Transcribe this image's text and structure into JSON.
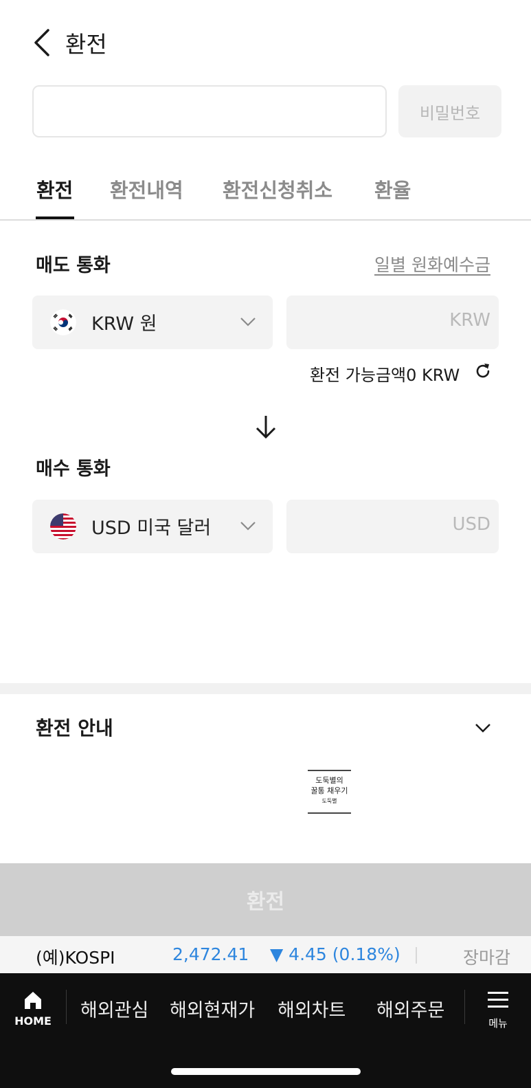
{
  "header": {
    "title": "환전"
  },
  "account": {
    "password_label": "비밀번호"
  },
  "tabs": [
    {
      "label": "환전",
      "active": true
    },
    {
      "label": "환전내역",
      "active": false
    },
    {
      "label": "환전신청취소",
      "active": false
    },
    {
      "label": "환율",
      "active": false
    }
  ],
  "sell": {
    "label": "매도 통화",
    "deposit_link": "일별 원화예수금",
    "currency": "KRW 원",
    "flag_icon": "korea-flag-icon",
    "amount_unit": "KRW",
    "available_text": "환전 가능금액0 KRW"
  },
  "buy": {
    "label": "매수 통화",
    "currency": "USD 미국 달러",
    "flag_icon": "usa-flag-icon",
    "amount_unit": "USD"
  },
  "guide": {
    "title": "환전 안내"
  },
  "watermark": {
    "line1": "도둑별의",
    "line2": "꿀통 채우기",
    "line3": "도둑별"
  },
  "exchange_button": "환전",
  "ticker": {
    "name": "(예)KOSPI",
    "value": "2,472.41",
    "change": "▼ 4.45 (0.18%)",
    "status": "장마감",
    "color": "#2e86de"
  },
  "bottom_nav": {
    "home": "HOME",
    "items": [
      "해외관심",
      "해외현재가",
      "해외차트",
      "해외주문"
    ],
    "menu": "메뉴"
  }
}
